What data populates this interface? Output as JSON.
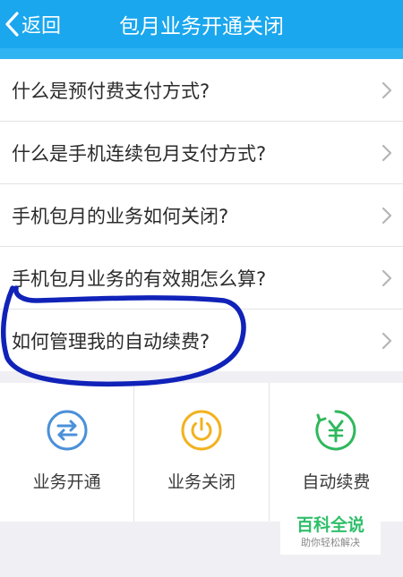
{
  "header": {
    "back_label": "返回",
    "title": "包月业务开通关闭",
    "color": "#1aa7ee"
  },
  "faq": [
    {
      "text": "什么是预付费支付方式?"
    },
    {
      "text": "什么是手机连续包月支付方式?"
    },
    {
      "text": "手机包月的业务如何关闭?"
    },
    {
      "text": "手机包月业务的有效期怎么算?"
    },
    {
      "text": "如何管理我的自动续费?"
    }
  ],
  "actions": [
    {
      "label": "业务开通",
      "icon": "swap-arrows-icon",
      "color": "#4a90d9"
    },
    {
      "label": "业务关闭",
      "icon": "power-icon",
      "color": "#f2b21f"
    },
    {
      "label": "自动续费",
      "icon": "yuan-renew-icon",
      "color": "#2fb85c"
    }
  ],
  "annotation": {
    "color": "#1022b8"
  },
  "watermark": {
    "main": "百科全说",
    "sub": "助你轻松解决"
  }
}
